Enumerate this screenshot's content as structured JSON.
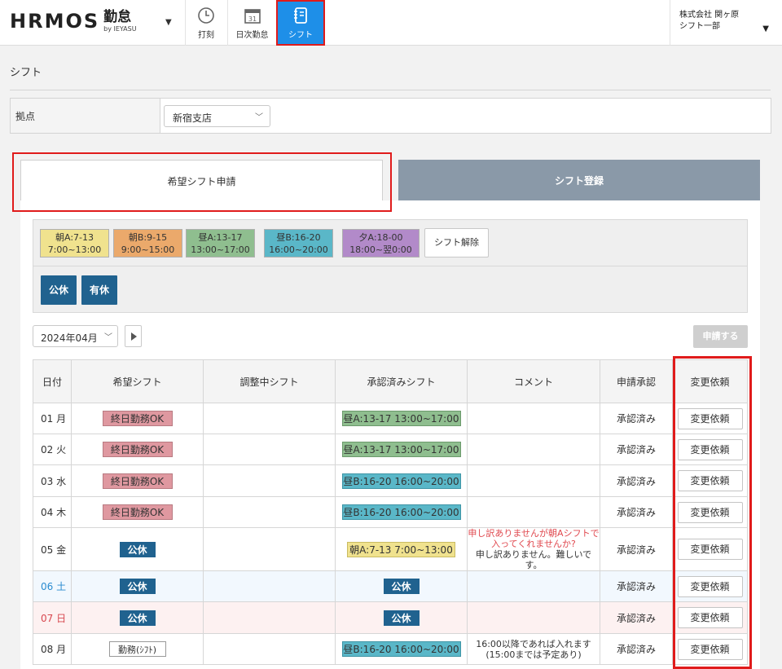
{
  "header": {
    "logo_main": "HRMOS",
    "logo_kanji": "勤怠",
    "logo_by": "by IEYASU",
    "nav": [
      {
        "label": "打刻",
        "icon": "clock-icon"
      },
      {
        "label": "日次勤怠",
        "icon": "calendar-icon"
      },
      {
        "label": "シフト",
        "icon": "shift-notebook-icon"
      }
    ],
    "company": "株式会社 関ヶ原",
    "department": "シフト一部"
  },
  "page": {
    "title": "シフト",
    "location_label": "拠点",
    "location_value": "新宿支店"
  },
  "tabs": [
    {
      "label": "希望シフト申請",
      "active": true
    },
    {
      "label": "シフト登録",
      "active": false
    }
  ],
  "palette": {
    "chips": [
      {
        "line1": "朝A:7-13",
        "line2": "7:00~13:00",
        "color": "#f0e28e"
      },
      {
        "line1": "朝B:9-15",
        "line2": "9:00~15:00",
        "color": "#eba96b"
      },
      {
        "line1": "昼A:13-17",
        "line2": "13:00~17:00",
        "color": "#8fbe8f"
      },
      {
        "line1": "昼B:16-20",
        "line2": "16:00~20:00",
        "color": "#5ab7c8"
      },
      {
        "line1": "夕A:18-00",
        "line2": "18:00~翌0:00",
        "color": "#b28ac9"
      }
    ],
    "clear_label": "シフト解除",
    "holidays": [
      "公休",
      "有休"
    ]
  },
  "toolbar": {
    "month": "2024年04月",
    "apply_label": "申請する"
  },
  "table": {
    "headers": [
      "日付",
      "希望シフト",
      "調整中シフト",
      "承認済みシフト",
      "コメント",
      "申請承認",
      "変更依頼"
    ],
    "rows": [
      {
        "date": "01 月",
        "wish": "終日勤務OK",
        "adjusting": "",
        "approved": "昼A:13-17 13:00~17:00",
        "comment_red": "",
        "comment": "",
        "status": "承認済み",
        "action": "変更依頼"
      },
      {
        "date": "02 火",
        "wish": "終日勤務OK",
        "adjusting": "",
        "approved": "昼A:13-17 13:00~17:00",
        "comment_red": "",
        "comment": "",
        "status": "承認済み",
        "action": "変更依頼"
      },
      {
        "date": "03 水",
        "wish": "終日勤務OK",
        "adjusting": "",
        "approved": "昼B:16-20 16:00~20:00",
        "comment_red": "",
        "comment": "",
        "status": "承認済み",
        "action": "変更依頼"
      },
      {
        "date": "04 木",
        "wish": "終日勤務OK",
        "adjusting": "",
        "approved": "昼B:16-20 16:00~20:00",
        "comment_red": "",
        "comment": "",
        "status": "承認済み",
        "action": "変更依頼"
      },
      {
        "date": "05 金",
        "wish": "公休",
        "adjusting": "",
        "approved": "朝A:7-13 7:00~13:00",
        "comment_red": "申し訳ありませんが朝Aシフトで入ってくれませんか?",
        "comment": "申し訳ありません。難しいです。",
        "status": "承認済み",
        "action": "変更依頼"
      },
      {
        "date": "06 土",
        "wish": "公休",
        "adjusting": "",
        "approved": "公休",
        "comment_red": "",
        "comment": "",
        "status": "承認済み",
        "action": "変更依頼"
      },
      {
        "date": "07 日",
        "wish": "公休",
        "adjusting": "",
        "approved": "公休",
        "comment_red": "",
        "comment": "",
        "status": "承認済み",
        "action": "変更依頼"
      },
      {
        "date": "08 月",
        "wish": "勤務(ｼﾌﾄ)",
        "adjusting": "",
        "approved": "昼B:16-20 16:00~20:00",
        "comment_red": "",
        "comment": "16:00以降であれば入れます(15:00までは予定あり)",
        "status": "承認済み",
        "action": "変更依頼"
      }
    ]
  }
}
